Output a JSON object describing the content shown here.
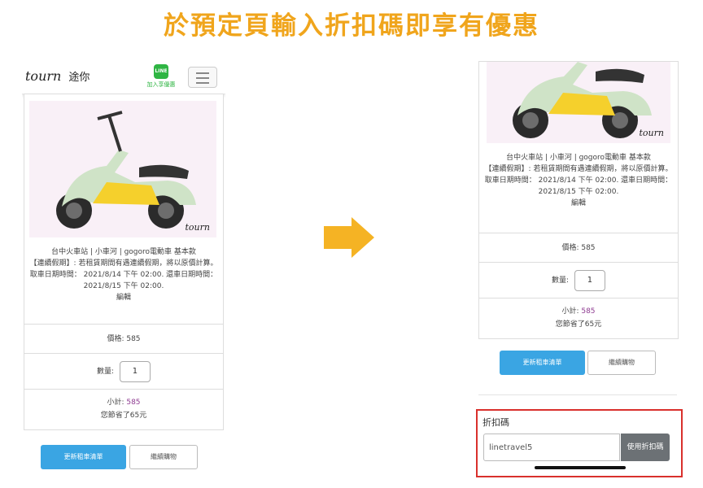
{
  "headline": "於預定頁輸入折扣碼即享有優惠",
  "navbar": {
    "logo_text": "tourn",
    "logo_brand": "途你",
    "line_icon_text": "LINE",
    "line_label": "加入享優惠"
  },
  "product": {
    "brand_mark": "tourn",
    "title": "台中火車站 | 小車河 | gogoro電動車 基本款",
    "note": "【連續假期】: 若租賃期間有遇連續假期，將以原價計算。",
    "pickup": "取車日期時間： 2021/8/14 下午 02:00. 還車日期時間： 2021/8/15 下午 02:00.",
    "edit_link": "編輯",
    "price_label": "價格:",
    "price_value": "585",
    "qty_label": "數量:",
    "qty_value": "1",
    "subtotal_label": "小計:",
    "subtotal_value": "585",
    "savings": "您節省了65元"
  },
  "buttons": {
    "update_cart": "更新租車清單",
    "continue_shopping": "繼續購物"
  },
  "coupon": {
    "title": "折扣碼",
    "input_value": "linetravel5",
    "apply_label": "使用折扣碼"
  },
  "colors": {
    "headline": "#f0a51c",
    "arrow": "#f5b324",
    "primary_button": "#3aa5e3",
    "subtotal": "#8e3b91",
    "highlight_border": "#d9302c",
    "line_green": "#2fb543"
  },
  "icons": {
    "menu": "hamburger-icon",
    "line": "line-icon",
    "transition": "arrow-right-icon"
  }
}
